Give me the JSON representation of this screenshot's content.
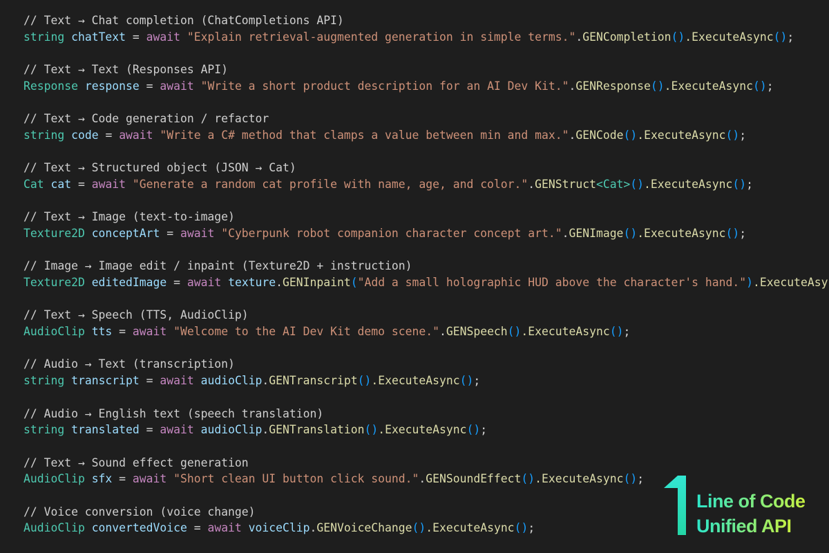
{
  "code_lines": [
    {
      "comment": "// Text → Chat completion (ChatCompletions API)"
    },
    {
      "type": "string",
      "var": "chatText",
      "op": " = ",
      "await": "await",
      "target": "\"Explain retrieval-augmented generation in simple terms.\"",
      "dot": ".",
      "method": "GENCompletion",
      "generic": "",
      "args": "",
      "tail": ".ExecuteAsync",
      "end": ";"
    },
    {
      "comment": "// Text → Text (Responses API)"
    },
    {
      "type": "Response",
      "var": "response",
      "op": " = ",
      "await": "await",
      "target": "\"Write a short product description for an AI Dev Kit.\"",
      "dot": ".",
      "method": "GENResponse",
      "generic": "",
      "args": "",
      "tail": ".ExecuteAsync",
      "end": ";"
    },
    {
      "comment": "// Text → Code generation / refactor"
    },
    {
      "type": "string",
      "var": "code",
      "op": " = ",
      "await": "await",
      "target": "\"Write a C# method that clamps a value between min and max.\"",
      "dot": ".",
      "method": "GENCode",
      "generic": "",
      "args": "",
      "tail": ".ExecuteAsync",
      "end": ";"
    },
    {
      "comment": "// Text → Structured object (JSON → Cat)"
    },
    {
      "type": "Cat",
      "var": "cat",
      "op": " = ",
      "await": "await",
      "target": "\"Generate a random cat profile with name, age, and color.\"",
      "dot": ".",
      "method": "GENStruct",
      "generic": "<Cat>",
      "args": "",
      "tail": ".ExecuteAsync",
      "end": ";"
    },
    {
      "comment": "// Text → Image (text-to-image)"
    },
    {
      "type": "Texture2D",
      "var": "conceptArt",
      "op": " = ",
      "await": "await",
      "target": "\"Cyberpunk robot companion character concept art.\"",
      "dot": ".",
      "method": "GENImage",
      "generic": "",
      "args": "",
      "tail": ".ExecuteAsync",
      "end": ";"
    },
    {
      "comment": "// Image → Image edit / inpaint (Texture2D + instruction)"
    },
    {
      "type": "Texture2D",
      "var": "editedImage",
      "op": " = ",
      "await": "await",
      "target": "texture",
      "dot": ".",
      "method": "GENInpaint",
      "generic": "",
      "args": "\"Add a small holographic HUD above the character's hand.\"",
      "tail": ".ExecuteAsync",
      "end": ";"
    },
    {
      "comment": "// Text → Speech (TTS, AudioClip)"
    },
    {
      "type": "AudioClip",
      "var": "tts",
      "op": " = ",
      "await": "await",
      "target": "\"Welcome to the AI Dev Kit demo scene.\"",
      "dot": ".",
      "method": "GENSpeech",
      "generic": "",
      "args": "",
      "tail": ".ExecuteAsync",
      "end": ";"
    },
    {
      "comment": "// Audio → Text (transcription)"
    },
    {
      "type": "string",
      "var": "transcript",
      "op": " = ",
      "await": "await",
      "target": "audioClip",
      "dot": ".",
      "method": "GENTranscript",
      "generic": "",
      "args": "",
      "tail": ".ExecuteAsync",
      "end": ";"
    },
    {
      "comment": "// Audio → English text (speech translation)"
    },
    {
      "type": "string",
      "var": "translated",
      "op": " = ",
      "await": "await",
      "target": "audioClip",
      "dot": ".",
      "method": "GENTranslation",
      "generic": "",
      "args": "",
      "tail": ".ExecuteAsync",
      "end": ";"
    },
    {
      "comment": "// Text → Sound effect generation"
    },
    {
      "type": "AudioClip",
      "var": "sfx",
      "op": " = ",
      "await": "await",
      "target": "\"Short clean UI button click sound.\"",
      "dot": ".",
      "method": "GENSoundEffect",
      "generic": "",
      "args": "",
      "tail": ".ExecuteAsync",
      "end": ";"
    },
    {
      "comment": "// Voice conversion (voice change)"
    },
    {
      "type": "AudioClip",
      "var": "convertedVoice",
      "op": " = ",
      "await": "await",
      "target": "voiceClip",
      "dot": ".",
      "method": "GENVoiceChange",
      "generic": "",
      "args": "",
      "tail": ".ExecuteAsync",
      "end": ";"
    }
  ],
  "branding": {
    "number": "1",
    "line1": "Line of Code",
    "line2": "Unified API",
    "gradient_start": "#2de6c9",
    "gradient_end": "#c8f040"
  },
  "colors": {
    "background": "#1e1e1e",
    "comment_slashes": "#6a9955",
    "type": "#4ec9b0",
    "keyword": "#569cd6",
    "variable": "#9cdcfe",
    "await": "#c586c0",
    "string": "#ce9178",
    "method": "#dcdcaa",
    "parentheses": "#179fff"
  }
}
